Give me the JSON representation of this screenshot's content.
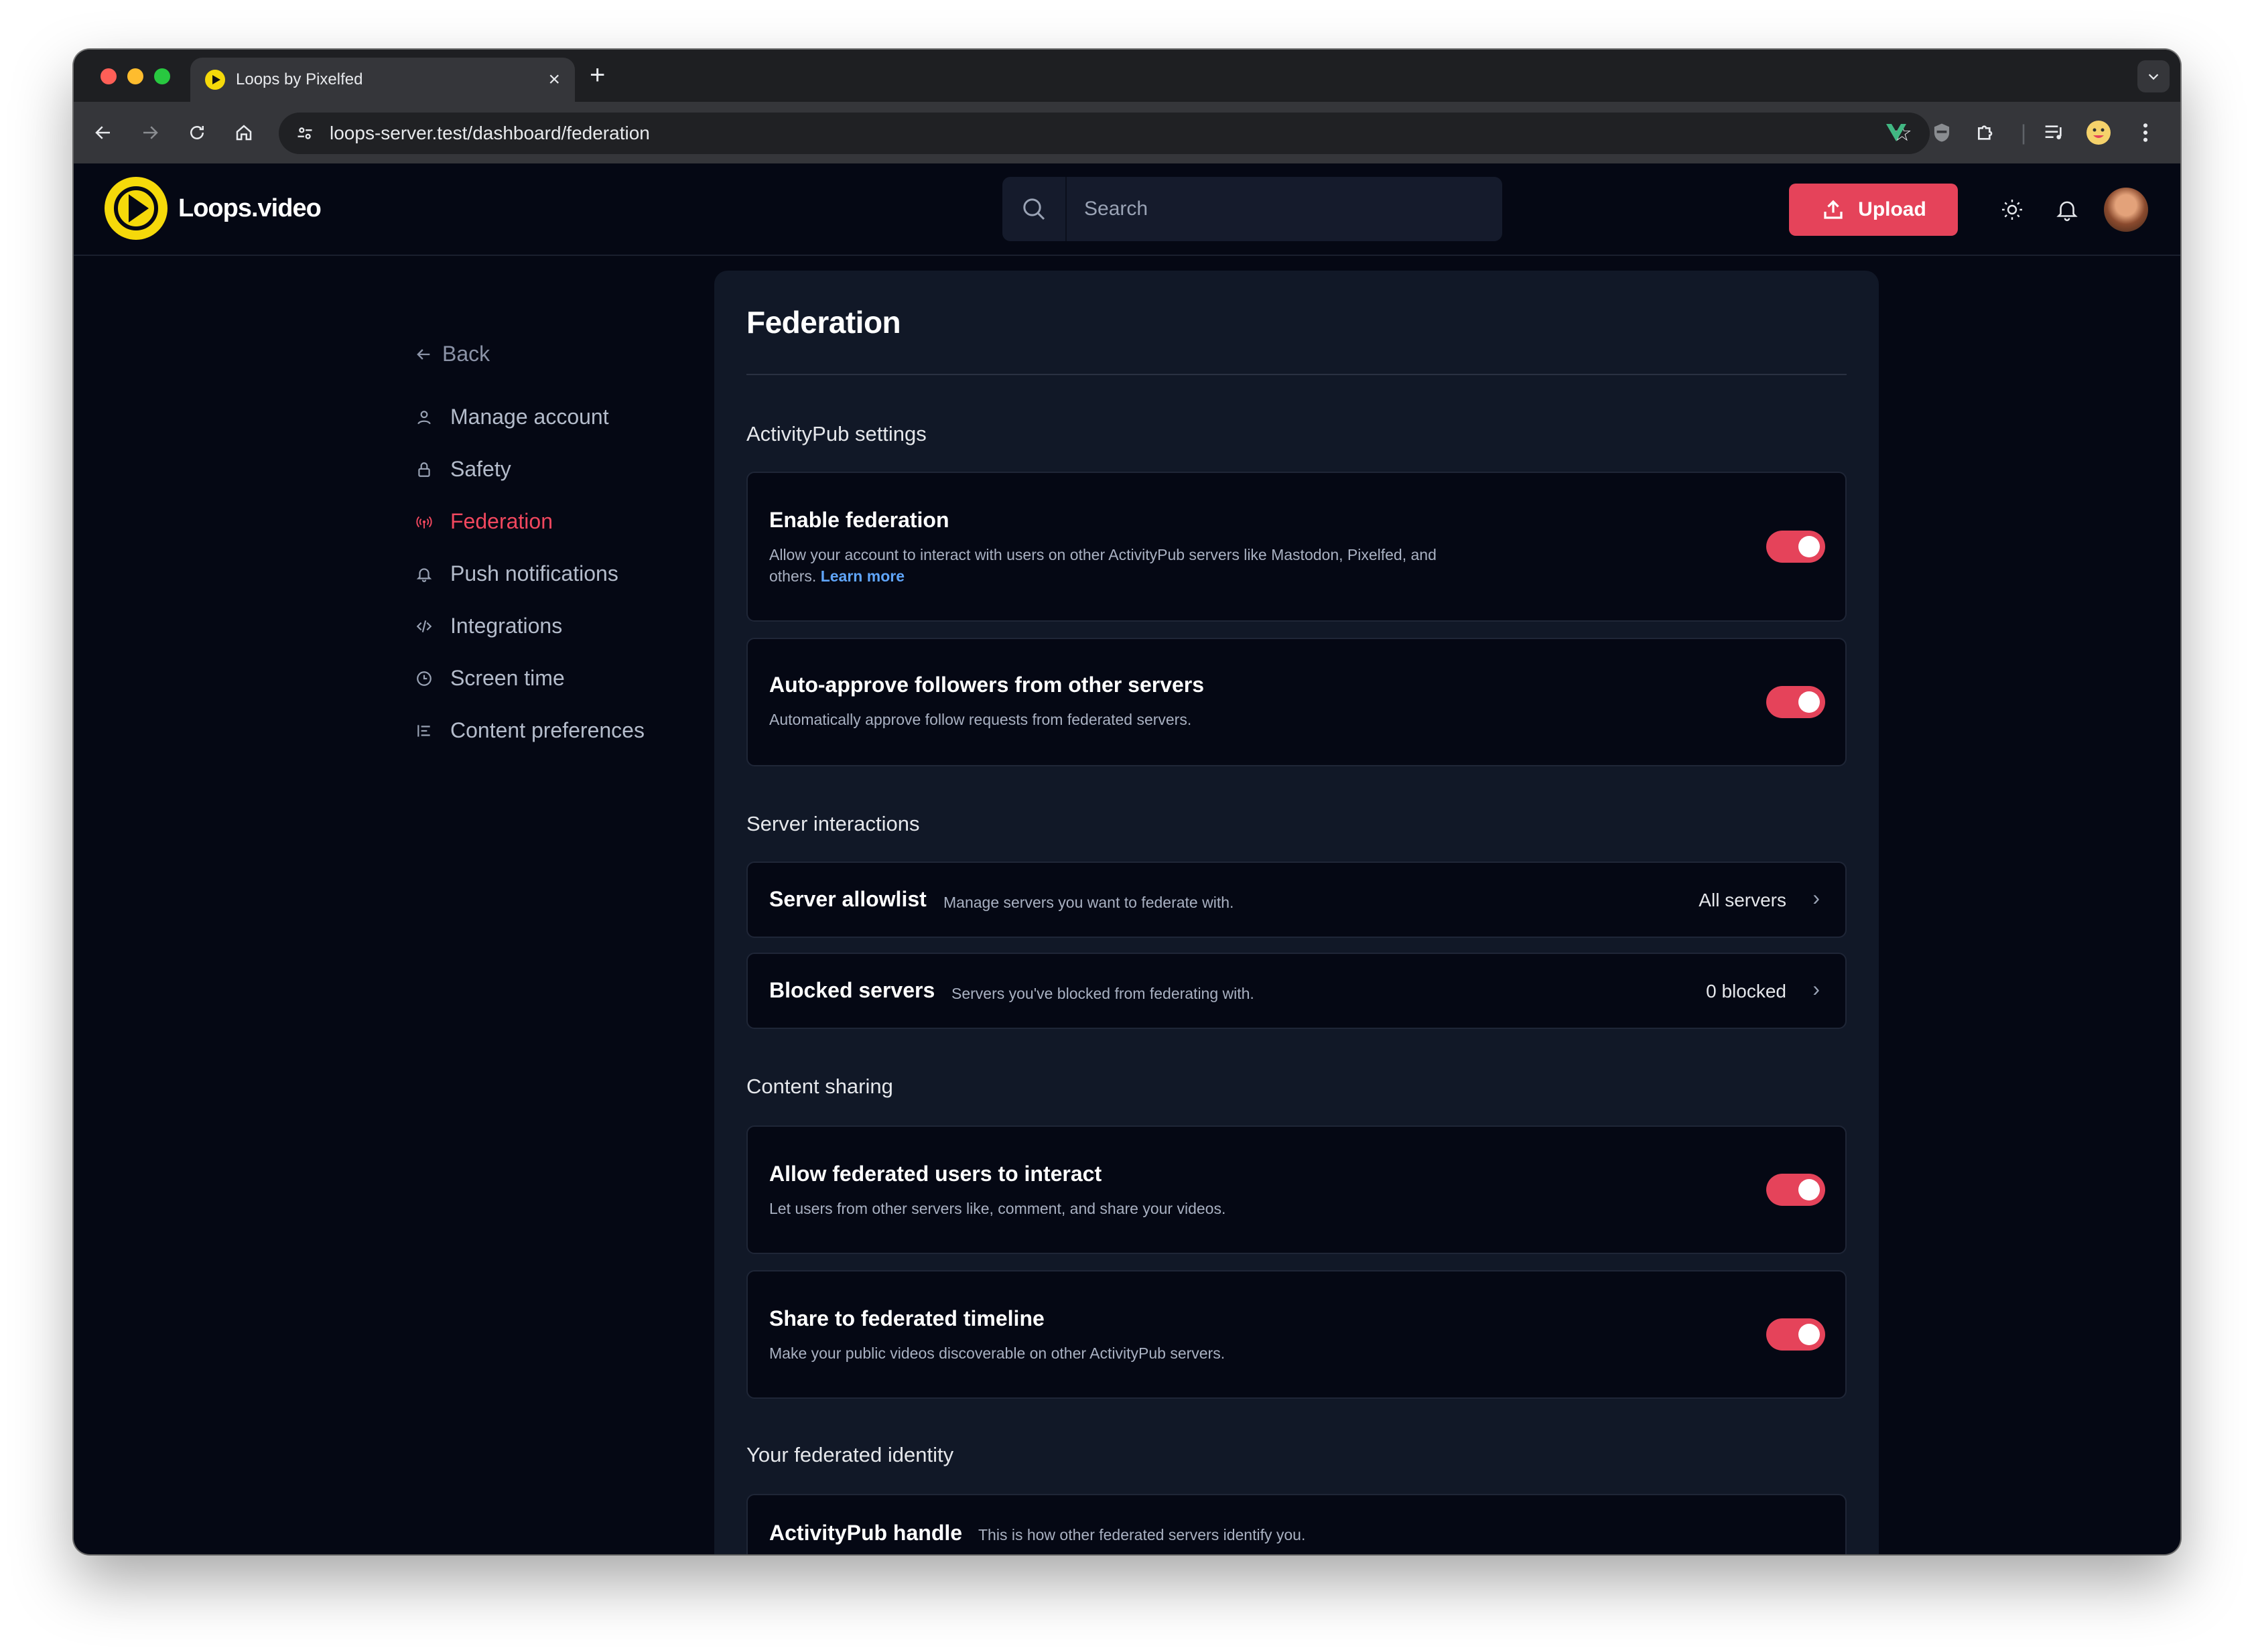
{
  "browser": {
    "tab_title": "Loops by Pixelfed",
    "tab_close": "×",
    "new_tab": "+",
    "url": "loops-server.test/dashboard/federation"
  },
  "header": {
    "logo_text": "Loops.video",
    "search_placeholder": "Search",
    "upload_label": "Upload"
  },
  "sidebar": {
    "back_label": "Back",
    "items": [
      {
        "label": "Manage account",
        "icon": "user-icon"
      },
      {
        "label": "Safety",
        "icon": "lock-icon"
      },
      {
        "label": "Federation",
        "icon": "broadcast-icon",
        "active": true
      },
      {
        "label": "Push notifications",
        "icon": "bell-icon"
      },
      {
        "label": "Integrations",
        "icon": "code-icon"
      },
      {
        "label": "Screen time",
        "icon": "clock-icon"
      },
      {
        "label": "Content preferences",
        "icon": "list-icon"
      }
    ]
  },
  "main": {
    "title": "Federation",
    "sections": {
      "activitypub": "ActivityPub settings",
      "server_interactions": "Server interactions",
      "content_sharing": "Content sharing",
      "identity": "Your federated identity"
    },
    "enable_federation": {
      "title": "Enable federation",
      "desc": "Allow your account to interact with users on other ActivityPub servers like Mastodon, Pixelfed, and others.",
      "link": "Learn more",
      "enabled": true
    },
    "auto_approve": {
      "title": "Auto-approve followers from other servers",
      "desc": "Automatically approve follow requests from federated servers.",
      "enabled": true
    },
    "allowlist": {
      "title": "Server allowlist",
      "desc": "Manage servers you want to federate with.",
      "value": "All servers"
    },
    "blocked": {
      "title": "Blocked servers",
      "desc": "Servers you've blocked from federating with.",
      "value": "0 blocked"
    },
    "allow_interact": {
      "title": "Allow federated users to interact",
      "desc": "Let users from other servers like, comment, and share your videos.",
      "enabled": true
    },
    "share_timeline": {
      "title": "Share to federated timeline",
      "desc": "Make your public videos discoverable on other ActivityPub servers.",
      "enabled": true
    },
    "handle": {
      "title": "ActivityPub handle",
      "desc": "This is how other federated servers identify you."
    }
  },
  "colors": {
    "accent": "#e5435a",
    "active_nav": "#f0475e",
    "link": "#60a5fa",
    "background": "#050814",
    "panel": "#111827"
  }
}
